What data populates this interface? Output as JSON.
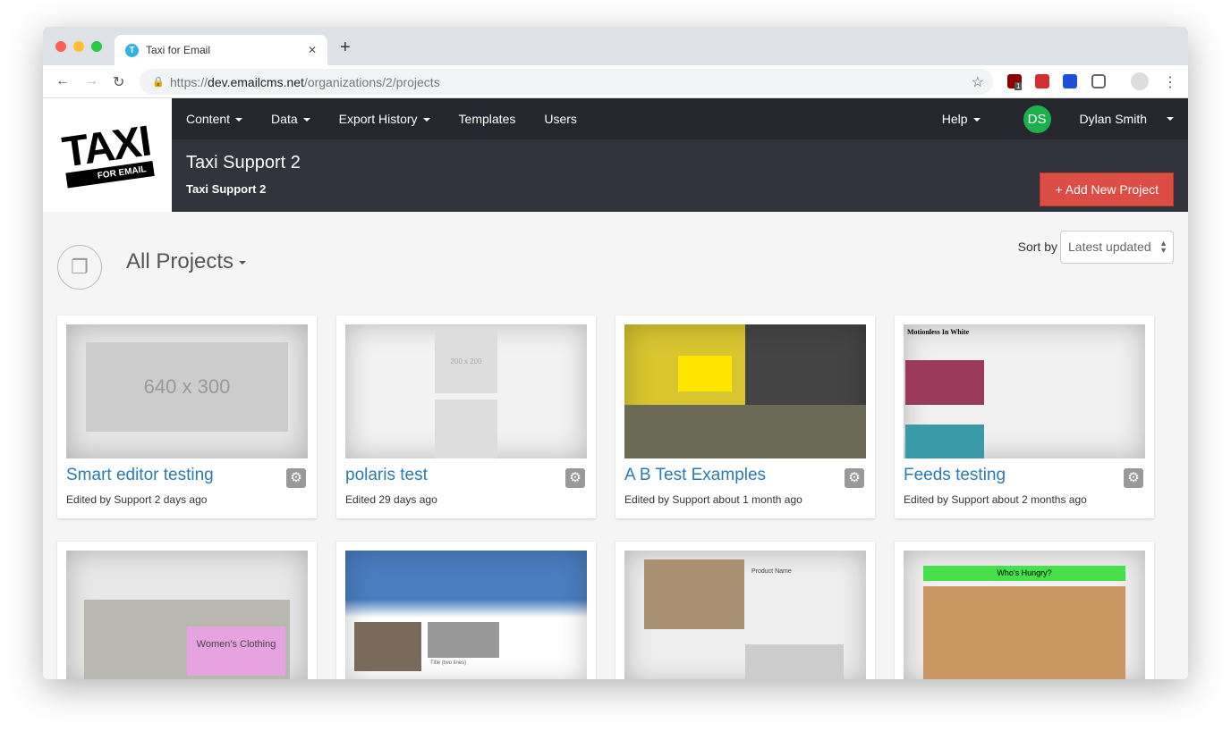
{
  "browser": {
    "tab_title": "Taxi for Email",
    "url_scheme": "https://",
    "url_host": "dev.emailcms.net",
    "url_path": "/organizations/2/projects",
    "ext_badge": "1"
  },
  "logo": {
    "line1": "TAXI",
    "line2": "FOR EMAIL"
  },
  "nav": {
    "items": [
      "Content",
      "Data",
      "Export History",
      "Templates",
      "Users"
    ],
    "help": "Help",
    "user_initials": "DS",
    "user_name": "Dylan Smith"
  },
  "header": {
    "title": "Taxi Support 2",
    "subtitle": "Taxi Support 2",
    "add_button": "+ Add New Project"
  },
  "projects_heading": "All Projects",
  "sort": {
    "label": "Sort by",
    "value": "Latest updated"
  },
  "colors": {
    "accent": "#db4d45",
    "nav": "#26262e",
    "header": "#33333d",
    "link": "#2a7ab8",
    "avatar": "#1cb04a"
  },
  "cards": [
    {
      "title": "Smart editor testing",
      "sub": "Edited by Support 2 days ago",
      "thumb": "640 x 300"
    },
    {
      "title": "polaris test",
      "sub": "Edited 29 days ago",
      "thumb": "200 x 200"
    },
    {
      "title": "A B Test Examples",
      "sub": "Edited by Support about 1 month ago",
      "thumb": ""
    },
    {
      "title": "Feeds testing",
      "sub": "Edited by Support about 2 months ago",
      "thumb": "Motionless In White"
    },
    {
      "thumb": "Women's Clothing"
    },
    {
      "thumb": "Title (two lines)"
    },
    {
      "thumb": "Product Name"
    },
    {
      "thumb": "Who's Hungry?"
    }
  ]
}
